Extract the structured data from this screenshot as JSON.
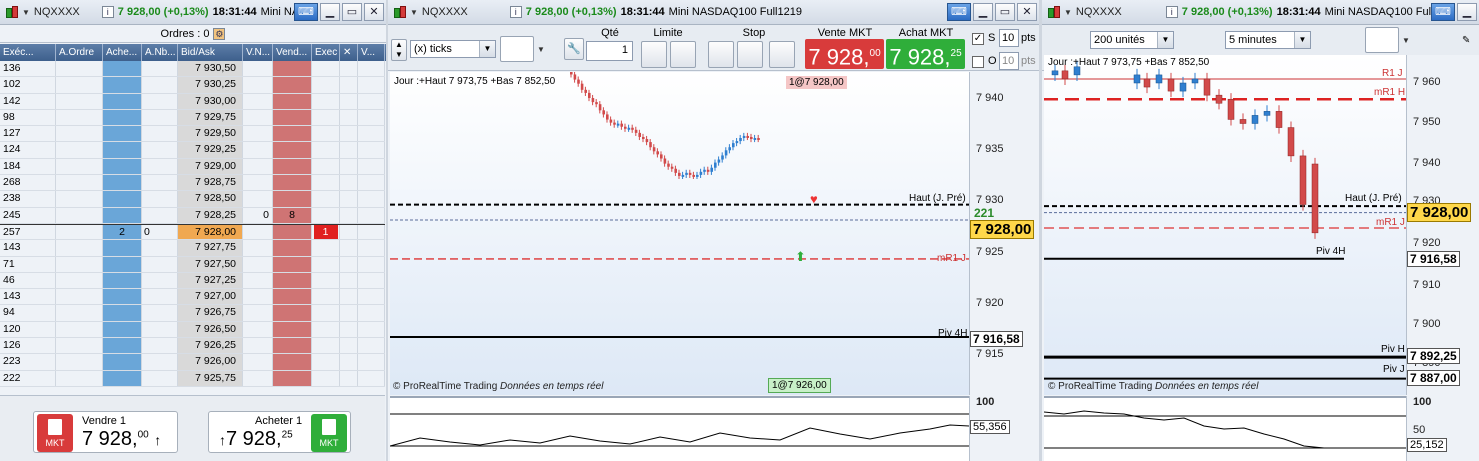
{
  "app": {
    "symbol": "NQXXXX",
    "last": "7 928,00 (+0,13%)",
    "time": "18:31:44",
    "instrument_short": "Mini NAS",
    "instrument_full": "Mini NASDAQ100 Full1219",
    "instrument_3": "Mini NASDAQ100 Full"
  },
  "dom": {
    "ordres_label": "Ordres : 0",
    "headers": [
      "Exéc...",
      "A.Ordre",
      "Ache...",
      "A.Nb...",
      "Bid/Ask",
      "V.N...",
      "Vend...",
      "Exec",
      "",
      "V..."
    ],
    "rows": [
      {
        "exec": "136",
        "achat": "",
        "anb": "",
        "price": "7 930,50",
        "vnb": "",
        "vend": ""
      },
      {
        "exec": "102",
        "achat": "",
        "anb": "",
        "price": "7 930,25",
        "vnb": "",
        "vend": ""
      },
      {
        "exec": "142",
        "achat": "",
        "anb": "",
        "price": "7 930,00",
        "vnb": "",
        "vend": ""
      },
      {
        "exec": "98",
        "achat": "",
        "anb": "",
        "price": "7 929,75",
        "vnb": "",
        "vend": ""
      },
      {
        "exec": "127",
        "achat": "",
        "anb": "",
        "price": "7 929,50",
        "vnb": "",
        "vend": ""
      },
      {
        "exec": "124",
        "achat": "",
        "anb": "",
        "price": "7 929,25",
        "vnb": "",
        "vend": ""
      },
      {
        "exec": "184",
        "achat": "",
        "anb": "",
        "price": "7 929,00",
        "vnb": "",
        "vend": ""
      },
      {
        "exec": "268",
        "achat": "",
        "anb": "",
        "price": "7 928,75",
        "vnb": "",
        "vend": ""
      },
      {
        "exec": "238",
        "achat": "",
        "anb": "",
        "price": "7 928,50",
        "vnb": "",
        "vend": ""
      },
      {
        "exec": "245",
        "achat": "",
        "anb": "",
        "price": "7 928,25",
        "vnb": "0",
        "vend": "8"
      },
      {
        "exec": "257",
        "achat": "2",
        "anb": "0",
        "price": "7 928,00",
        "vnb": "",
        "vend": "",
        "execv": "1"
      },
      {
        "exec": "143",
        "achat": "",
        "anb": "",
        "price": "7 927,75",
        "vnb": "",
        "vend": ""
      },
      {
        "exec": "71",
        "achat": "",
        "anb": "",
        "price": "7 927,50",
        "vnb": "",
        "vend": ""
      },
      {
        "exec": "46",
        "achat": "",
        "anb": "",
        "price": "7 927,25",
        "vnb": "",
        "vend": ""
      },
      {
        "exec": "143",
        "achat": "",
        "anb": "",
        "price": "7 927,00",
        "vnb": "",
        "vend": ""
      },
      {
        "exec": "94",
        "achat": "",
        "anb": "",
        "price": "7 926,75",
        "vnb": "",
        "vend": ""
      },
      {
        "exec": "120",
        "achat": "",
        "anb": "",
        "price": "7 926,50",
        "vnb": "",
        "vend": ""
      },
      {
        "exec": "126",
        "achat": "",
        "anb": "",
        "price": "7 926,25",
        "vnb": "",
        "vend": ""
      },
      {
        "exec": "223",
        "achat": "",
        "anb": "",
        "price": "7 926,00",
        "vnb": "",
        "vend": ""
      },
      {
        "exec": "222",
        "achat": "",
        "anb": "",
        "price": "7 925,75",
        "vnb": "",
        "vend": ""
      }
    ],
    "sell_label": "Vendre 1",
    "sell_price_main": "7 928,",
    "sell_price_dec": "00",
    "buy_label": "Acheter 1",
    "buy_price_main": "7 928,",
    "buy_price_dec": "25",
    "mkt": "MKT"
  },
  "chart2": {
    "ticks_select": "(x) ticks",
    "qty_label": "Qté",
    "qty_value": "1",
    "limit_label": "Limite",
    "stop_label": "Stop",
    "sell_mkt_label": "Vente MKT",
    "buy_mkt_label": "Achat MKT",
    "sell_mkt_main": "7 928,",
    "sell_mkt_dec": "00",
    "buy_mkt_main": "7 928,",
    "buy_mkt_dec": "25",
    "s_label": "S",
    "o_label": "O",
    "pts_value": "10",
    "pts_label": "pts",
    "day_info": "Jour :+Haut 7 973,75 +Bas 7 852,50",
    "top_order": "1@7 928,00",
    "bottom_order": "1@7 926,00",
    "haut_label": "Haut (J. Pré)",
    "mr1j_label": "mR1 J",
    "piv4h_label": "Piv 4H",
    "copyright": "© ProRealTime Trading",
    "realtime": "Données en temps réel",
    "axis_labels": [
      "7 940",
      "7 935",
      "7 930",
      "7 925",
      "7 920",
      "7 915"
    ],
    "tag_221": "221",
    "tag_price": "7 928,00",
    "tag_piv": "7 916,58",
    "osc_100": "100",
    "osc_val": "55,356"
  },
  "chart3": {
    "units_select": "200 unités",
    "tf_select": "5 minutes",
    "day_info": "Jour :+Haut 7 973,75 +Bas 7 852,50",
    "r1j": "R1 J",
    "mr1h": "mR1 H",
    "haut_label": "Haut (J. Pré)",
    "mr1j": "mR1 J",
    "piv4h": "Piv 4H",
    "pivh": "Piv H",
    "pivj": "Piv J",
    "copyright": "© ProRealTime Trading",
    "realtime": "Données en temps réel",
    "axis_labels": [
      "7 960",
      "7 950",
      "7 940",
      "7 930",
      "7 920",
      "7 910",
      "7 900",
      "7 890"
    ],
    "tag_price": "7 928,00",
    "tag_piv4h": "7 916,58",
    "tag_pivh": "7 892,25",
    "tag_pivj": "7 887,00",
    "osc_100": "100",
    "osc_50": "50",
    "osc_val": "25,152"
  },
  "colors": {
    "up": "#2f7fd0",
    "down": "#d24a4a",
    "sell": "#d83b3b",
    "buy": "#2fae3a"
  }
}
